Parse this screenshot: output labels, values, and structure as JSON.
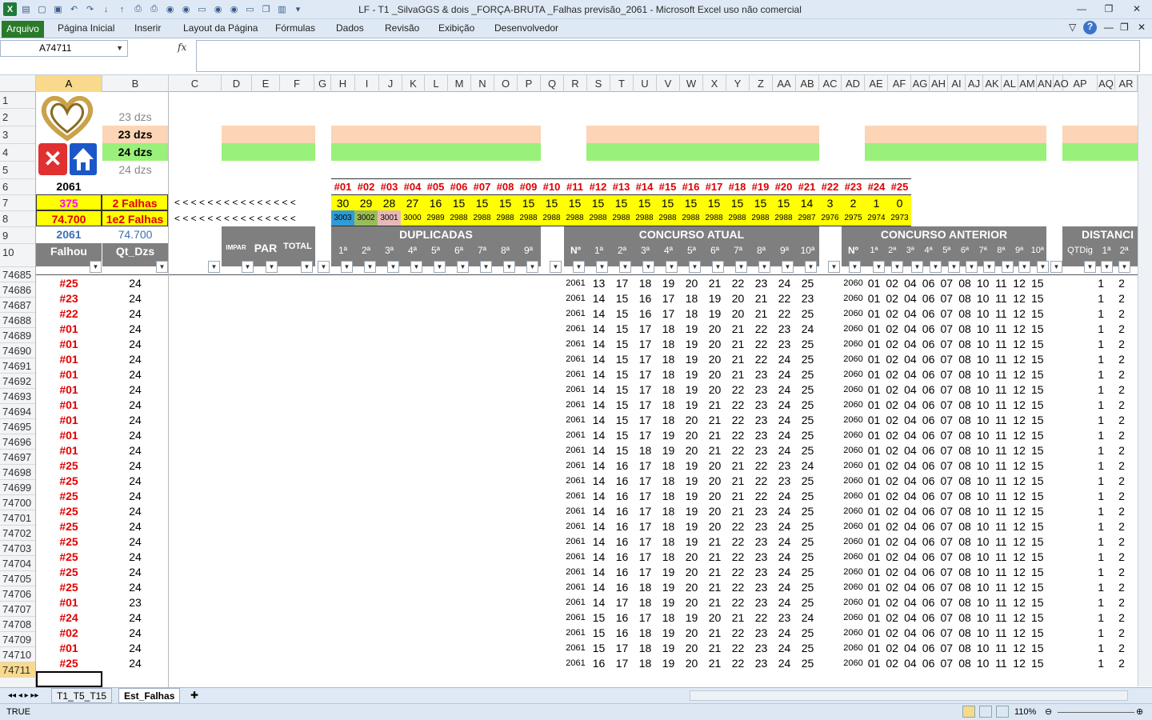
{
  "app": {
    "title": "LF - T1 _SilvaGGS & dois _FORÇA-BRUTA _Falhas previsão_2061 - Microsoft Excel uso não comercial"
  },
  "ribbon": {
    "file": "Arquivo",
    "tabs": [
      "Página Inicial",
      "Inserir",
      "Layout da Página",
      "Fórmulas",
      "Dados",
      "Revisão",
      "Exibição",
      "Desenvolvedor"
    ]
  },
  "formula": {
    "namebox": "A74711",
    "fx": "fx",
    "value": ""
  },
  "columns": [
    "A",
    "B",
    "C",
    "D",
    "E",
    "F",
    "G",
    "H",
    "I",
    "J",
    "K",
    "L",
    "M",
    "N",
    "O",
    "P",
    "Q",
    "R",
    "S",
    "T",
    "U",
    "V",
    "W",
    "X",
    "Y",
    "Z",
    "AA",
    "AB",
    "AC",
    "AD",
    "AE",
    "AF",
    "AG",
    "AH",
    "AI",
    "AJ",
    "AK",
    "AL",
    "AM",
    "AN",
    "AO",
    "AP",
    "AQ",
    "AR"
  ],
  "top": {
    "b2": "23 dzs",
    "b3": "23 dzs",
    "b4": "24 dzs",
    "b5": "24 dzs",
    "a6": "2061",
    "a7": "375",
    "b7": "2 Falhas",
    "a8": "74.700",
    "b8": "1e2 Falhas",
    "a9": "2061",
    "b9": "74.700",
    "a10": "Falhou",
    "b10": "Qt_Dzs",
    "arrows7": "< < < < < < < < < < < < < < <",
    "arrows8": "< < < < < < < < < < < < < < <"
  },
  "falhas": {
    "labels": [
      "#01",
      "#02",
      "#03",
      "#04",
      "#05",
      "#06",
      "#07",
      "#08",
      "#09",
      "#10",
      "#11",
      "#12",
      "#13",
      "#14",
      "#15",
      "#16",
      "#17",
      "#18",
      "#19",
      "#20",
      "#21",
      "#22",
      "#23",
      "#24",
      "#25"
    ],
    "row7": [
      "30",
      "29",
      "28",
      "27",
      "16",
      "15",
      "15",
      "15",
      "15",
      "15",
      "15",
      "15",
      "15",
      "15",
      "15",
      "15",
      "15",
      "15",
      "15",
      "15",
      "14",
      "3",
      "2",
      "1",
      "0"
    ],
    "row8": [
      "3003",
      "3002",
      "3001",
      "3000",
      "2989",
      "2988",
      "2988",
      "2988",
      "2988",
      "2988",
      "2988",
      "2988",
      "2988",
      "2988",
      "2988",
      "2988",
      "2988",
      "2988",
      "2988",
      "2988",
      "2987",
      "2976",
      "2975",
      "2974",
      "2973"
    ]
  },
  "headers": {
    "impar": "IMPAR",
    "par": "PAR",
    "total": "TOTAL",
    "duplicadas": "DUPLICADAS",
    "dup_cols": [
      "1ª",
      "2ª",
      "3ª",
      "4ª",
      "5ª",
      "6ª",
      "7ª",
      "8ª",
      "9ª"
    ],
    "atual": "CONCURSO ATUAL",
    "num": "Nº",
    "atual_cols": [
      "1ª",
      "2ª",
      "3ª",
      "4ª",
      "5ª",
      "6ª",
      "7ª",
      "8ª",
      "9ª",
      "10ª"
    ],
    "anterior": "CONCURSO ANTERIOR",
    "ant_cols": [
      "1ª",
      "2ª",
      "3ª",
      "4ª",
      "5ª",
      "6ª",
      "7ª",
      "8ª",
      "9ª",
      "10ª"
    ],
    "distancia": "DISTANCI",
    "qtdig": "QTDig",
    "dist_cols": [
      "1ª",
      "2ª"
    ]
  },
  "rows": [
    {
      "n": "74685",
      "f": "#25",
      "q": "24",
      "c": "2061",
      "a": [
        "13",
        "17",
        "18",
        "19",
        "20",
        "21",
        "22",
        "23",
        "24",
        "25"
      ]
    },
    {
      "n": "74686",
      "f": "#23",
      "q": "24",
      "c": "2061",
      "a": [
        "14",
        "15",
        "16",
        "17",
        "18",
        "19",
        "20",
        "21",
        "22",
        "23"
      ]
    },
    {
      "n": "74687",
      "f": "#22",
      "q": "24",
      "c": "2061",
      "a": [
        "14",
        "15",
        "16",
        "17",
        "18",
        "19",
        "20",
        "21",
        "22",
        "25"
      ]
    },
    {
      "n": "74688",
      "f": "#01",
      "q": "24",
      "c": "2061",
      "a": [
        "14",
        "15",
        "17",
        "18",
        "19",
        "20",
        "21",
        "22",
        "23",
        "24"
      ]
    },
    {
      "n": "74689",
      "f": "#01",
      "q": "24",
      "c": "2061",
      "a": [
        "14",
        "15",
        "17",
        "18",
        "19",
        "20",
        "21",
        "22",
        "23",
        "25"
      ]
    },
    {
      "n": "74690",
      "f": "#01",
      "q": "24",
      "c": "2061",
      "a": [
        "14",
        "15",
        "17",
        "18",
        "19",
        "20",
        "21",
        "22",
        "24",
        "25"
      ]
    },
    {
      "n": "74691",
      "f": "#01",
      "q": "24",
      "c": "2061",
      "a": [
        "14",
        "15",
        "17",
        "18",
        "19",
        "20",
        "21",
        "23",
        "24",
        "25"
      ]
    },
    {
      "n": "74692",
      "f": "#01",
      "q": "24",
      "c": "2061",
      "a": [
        "14",
        "15",
        "17",
        "18",
        "19",
        "20",
        "22",
        "23",
        "24",
        "25"
      ]
    },
    {
      "n": "74693",
      "f": "#01",
      "q": "24",
      "c": "2061",
      "a": [
        "14",
        "15",
        "17",
        "18",
        "19",
        "21",
        "22",
        "23",
        "24",
        "25"
      ]
    },
    {
      "n": "74694",
      "f": "#01",
      "q": "24",
      "c": "2061",
      "a": [
        "14",
        "15",
        "17",
        "18",
        "20",
        "21",
        "22",
        "23",
        "24",
        "25"
      ]
    },
    {
      "n": "74695",
      "f": "#01",
      "q": "24",
      "c": "2061",
      "a": [
        "14",
        "15",
        "17",
        "19",
        "20",
        "21",
        "22",
        "23",
        "24",
        "25"
      ]
    },
    {
      "n": "74696",
      "f": "#01",
      "q": "24",
      "c": "2061",
      "a": [
        "14",
        "15",
        "18",
        "19",
        "20",
        "21",
        "22",
        "23",
        "24",
        "25"
      ]
    },
    {
      "n": "74697",
      "f": "#25",
      "q": "24",
      "c": "2061",
      "a": [
        "14",
        "16",
        "17",
        "18",
        "19",
        "20",
        "21",
        "22",
        "23",
        "24"
      ]
    },
    {
      "n": "74698",
      "f": "#25",
      "q": "24",
      "c": "2061",
      "a": [
        "14",
        "16",
        "17",
        "18",
        "19",
        "20",
        "21",
        "22",
        "23",
        "25"
      ]
    },
    {
      "n": "74699",
      "f": "#25",
      "q": "24",
      "c": "2061",
      "a": [
        "14",
        "16",
        "17",
        "18",
        "19",
        "20",
        "21",
        "22",
        "24",
        "25"
      ]
    },
    {
      "n": "74700",
      "f": "#25",
      "q": "24",
      "c": "2061",
      "a": [
        "14",
        "16",
        "17",
        "18",
        "19",
        "20",
        "21",
        "23",
        "24",
        "25"
      ]
    },
    {
      "n": "74701",
      "f": "#25",
      "q": "24",
      "c": "2061",
      "a": [
        "14",
        "16",
        "17",
        "18",
        "19",
        "20",
        "22",
        "23",
        "24",
        "25"
      ]
    },
    {
      "n": "74702",
      "f": "#25",
      "q": "24",
      "c": "2061",
      "a": [
        "14",
        "16",
        "17",
        "18",
        "19",
        "21",
        "22",
        "23",
        "24",
        "25"
      ]
    },
    {
      "n": "74703",
      "f": "#25",
      "q": "24",
      "c": "2061",
      "a": [
        "14",
        "16",
        "17",
        "18",
        "20",
        "21",
        "22",
        "23",
        "24",
        "25"
      ]
    },
    {
      "n": "74704",
      "f": "#25",
      "q": "24",
      "c": "2061",
      "a": [
        "14",
        "16",
        "17",
        "19",
        "20",
        "21",
        "22",
        "23",
        "24",
        "25"
      ]
    },
    {
      "n": "74705",
      "f": "#25",
      "q": "24",
      "c": "2061",
      "a": [
        "14",
        "16",
        "18",
        "19",
        "20",
        "21",
        "22",
        "23",
        "24",
        "25"
      ]
    },
    {
      "n": "74706",
      "f": "#01",
      "q": "23",
      "c": "2061",
      "a": [
        "14",
        "17",
        "18",
        "19",
        "20",
        "21",
        "22",
        "23",
        "24",
        "25"
      ]
    },
    {
      "n": "74707",
      "f": "#24",
      "q": "24",
      "c": "2061",
      "a": [
        "15",
        "16",
        "17",
        "18",
        "19",
        "20",
        "21",
        "22",
        "23",
        "24"
      ]
    },
    {
      "n": "74708",
      "f": "#02",
      "q": "24",
      "c": "2061",
      "a": [
        "15",
        "16",
        "18",
        "19",
        "20",
        "21",
        "22",
        "23",
        "24",
        "25"
      ]
    },
    {
      "n": "74709",
      "f": "#01",
      "q": "24",
      "c": "2061",
      "a": [
        "15",
        "17",
        "18",
        "19",
        "20",
        "21",
        "22",
        "23",
        "24",
        "25"
      ]
    },
    {
      "n": "74710",
      "f": "#25",
      "q": "24",
      "c": "2061",
      "a": [
        "16",
        "17",
        "18",
        "19",
        "20",
        "21",
        "22",
        "23",
        "24",
        "25"
      ]
    }
  ],
  "anterior": {
    "c": "2060",
    "a": [
      "01",
      "02",
      "04",
      "06",
      "07",
      "08",
      "10",
      "11",
      "12",
      "15"
    ]
  },
  "dist": {
    "a": "1",
    "b": "2"
  },
  "lastrow": "74711",
  "sheets": [
    "T1_T5_T15",
    "Est_Falhas"
  ],
  "status": {
    "mode": "TRUE",
    "zoom": "110%"
  }
}
